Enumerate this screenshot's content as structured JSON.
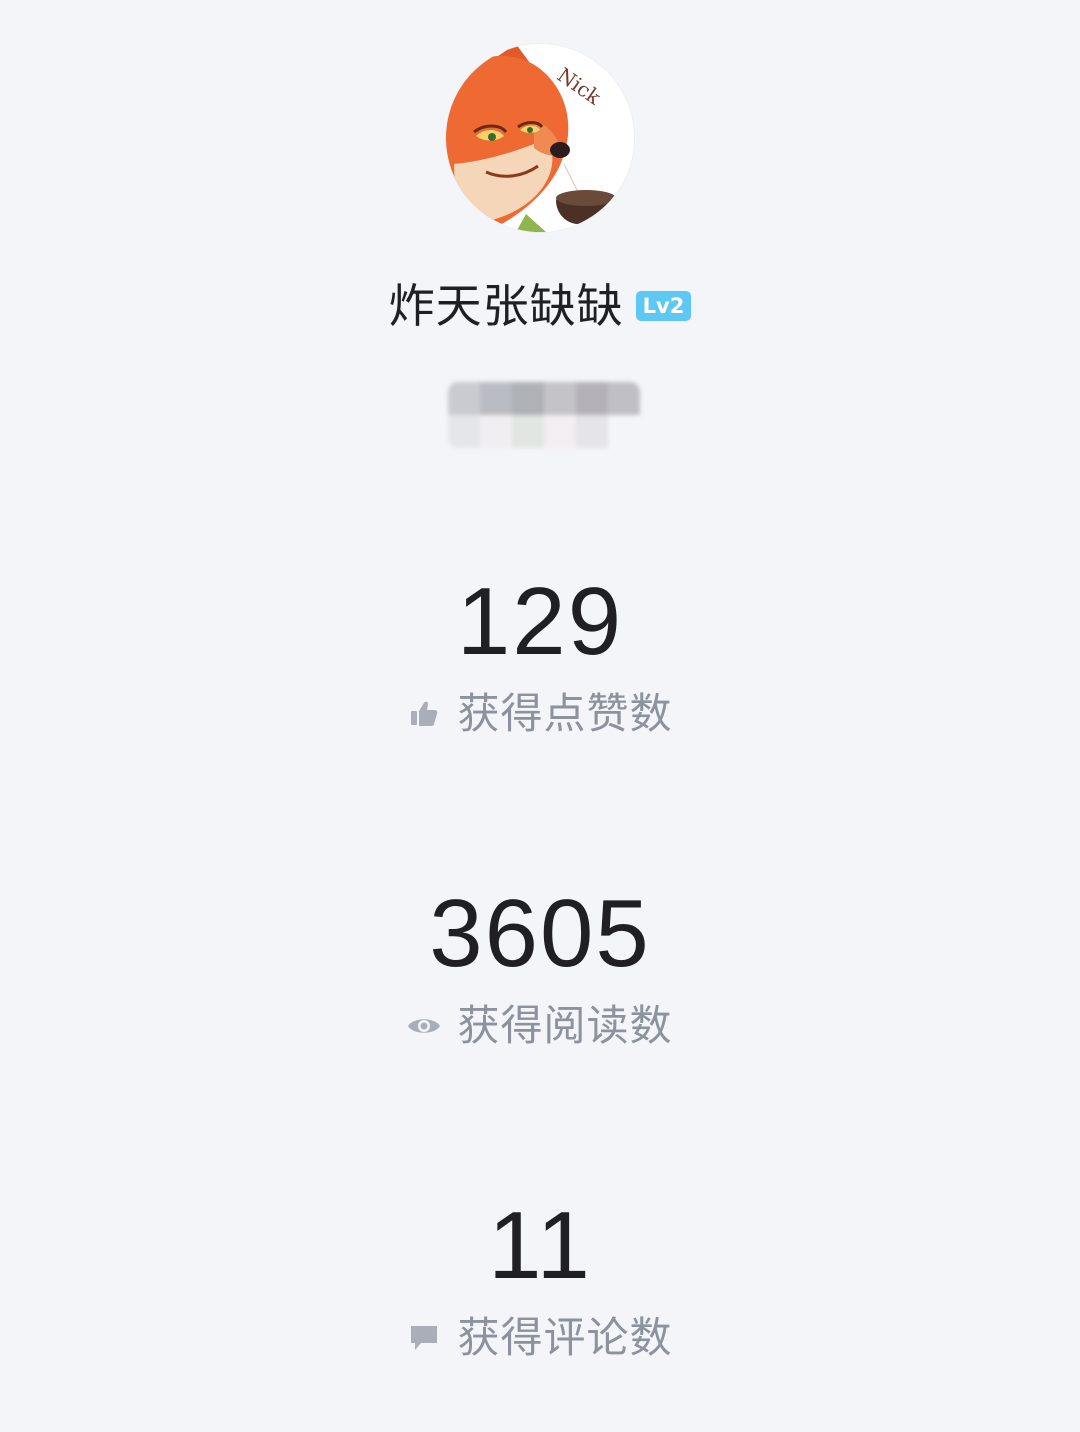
{
  "profile": {
    "username": "炸天张缺缺",
    "level_badge": "Lv2",
    "avatar_text": "Nick"
  },
  "stats": [
    {
      "value": "129",
      "label": "获得点赞数",
      "icon": "thumbs-up-icon"
    },
    {
      "value": "3605",
      "label": "获得阅读数",
      "icon": "eye-icon"
    },
    {
      "value": "11",
      "label": "获得评论数",
      "icon": "comment-icon"
    }
  ],
  "colors": {
    "background": "#f4f5f9",
    "level_badge": "#5ec8f4",
    "label_text": "#8c929e",
    "icon": "#a9aeb8"
  }
}
